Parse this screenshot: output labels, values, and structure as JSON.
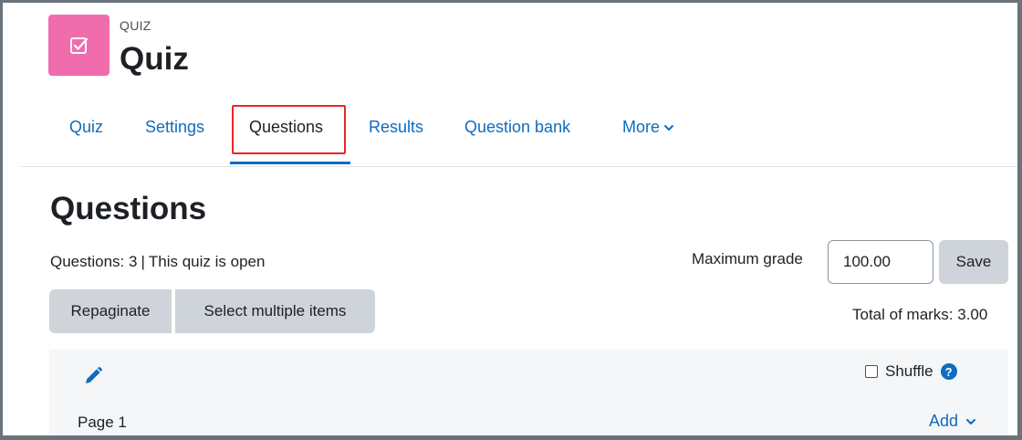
{
  "header": {
    "activity_kind": "QUIZ",
    "title": "Quiz",
    "icon": "checkbox-icon",
    "icon_color": "#f06dad"
  },
  "tabs": [
    {
      "label": "Quiz"
    },
    {
      "label": "Settings"
    },
    {
      "label": "Questions",
      "active": true
    },
    {
      "label": "Results"
    },
    {
      "label": "Question bank"
    },
    {
      "label": "More"
    }
  ],
  "main": {
    "heading": "Questions",
    "status": {
      "questions_count": "Questions: 3",
      "separator": "|",
      "quiz_state": "This quiz is open"
    },
    "max_grade_label": "Maximum grade",
    "max_grade_value": "100.00",
    "save_label": "Save",
    "repaginate_label": "Repaginate",
    "select_multiple_label": "Select multiple items",
    "total_marks": "Total of marks: 3.00"
  },
  "section": {
    "shuffle_label": "Shuffle",
    "shuffle_checked": false,
    "help_icon": "question-circle-icon",
    "page_label": "Page 1",
    "add_label": "Add"
  },
  "colors": {
    "link": "#0f6cbf",
    "highlight": "#e8262a",
    "button_bg": "#ced4da"
  }
}
